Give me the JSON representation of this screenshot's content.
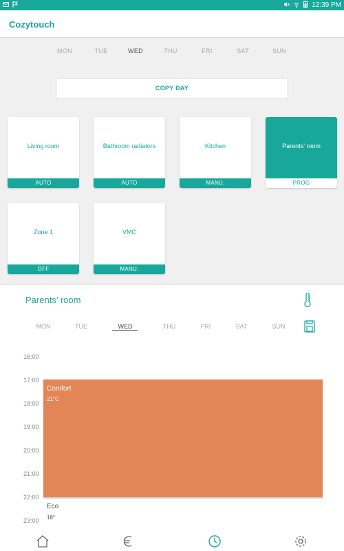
{
  "status_bar": {
    "time": "12:39 PM"
  },
  "app": {
    "title": "Cozytouch"
  },
  "top_days": [
    "MON",
    "TUE",
    "WED",
    "THU",
    "FRI",
    "SAT",
    "SUN"
  ],
  "copy_day_label": "COPY DAY",
  "zones": [
    {
      "name": "Living room",
      "mode": "AUTO"
    },
    {
      "name": "Bathroom radiators",
      "mode": "AUTO"
    },
    {
      "name": "Kitchen",
      "mode": "MANU."
    },
    {
      "name": "Parents’ room",
      "mode": "PROG",
      "selected": true
    },
    {
      "name": "Zone 1",
      "mode": "OFF"
    },
    {
      "name": "VMC",
      "mode": "MANU."
    }
  ],
  "schedule": {
    "title": "Parents’ room",
    "days": [
      "MON",
      "TUE",
      "WED",
      "THU",
      "FRI",
      "SAT",
      "SUN"
    ],
    "active_day": "WED",
    "times": [
      "16:00",
      "17:00",
      "18:00",
      "19:00",
      "20:00",
      "21:00",
      "22:00",
      "23:00"
    ],
    "comfort": {
      "label": "Comfort",
      "temp": "21°C",
      "color": "#e38557"
    },
    "eco": {
      "label": "Eco",
      "temp": "18°"
    }
  },
  "colors": {
    "accent": "#17a89b"
  },
  "nav": [
    "home-icon",
    "euro-icon",
    "clock-icon",
    "gear-icon"
  ]
}
